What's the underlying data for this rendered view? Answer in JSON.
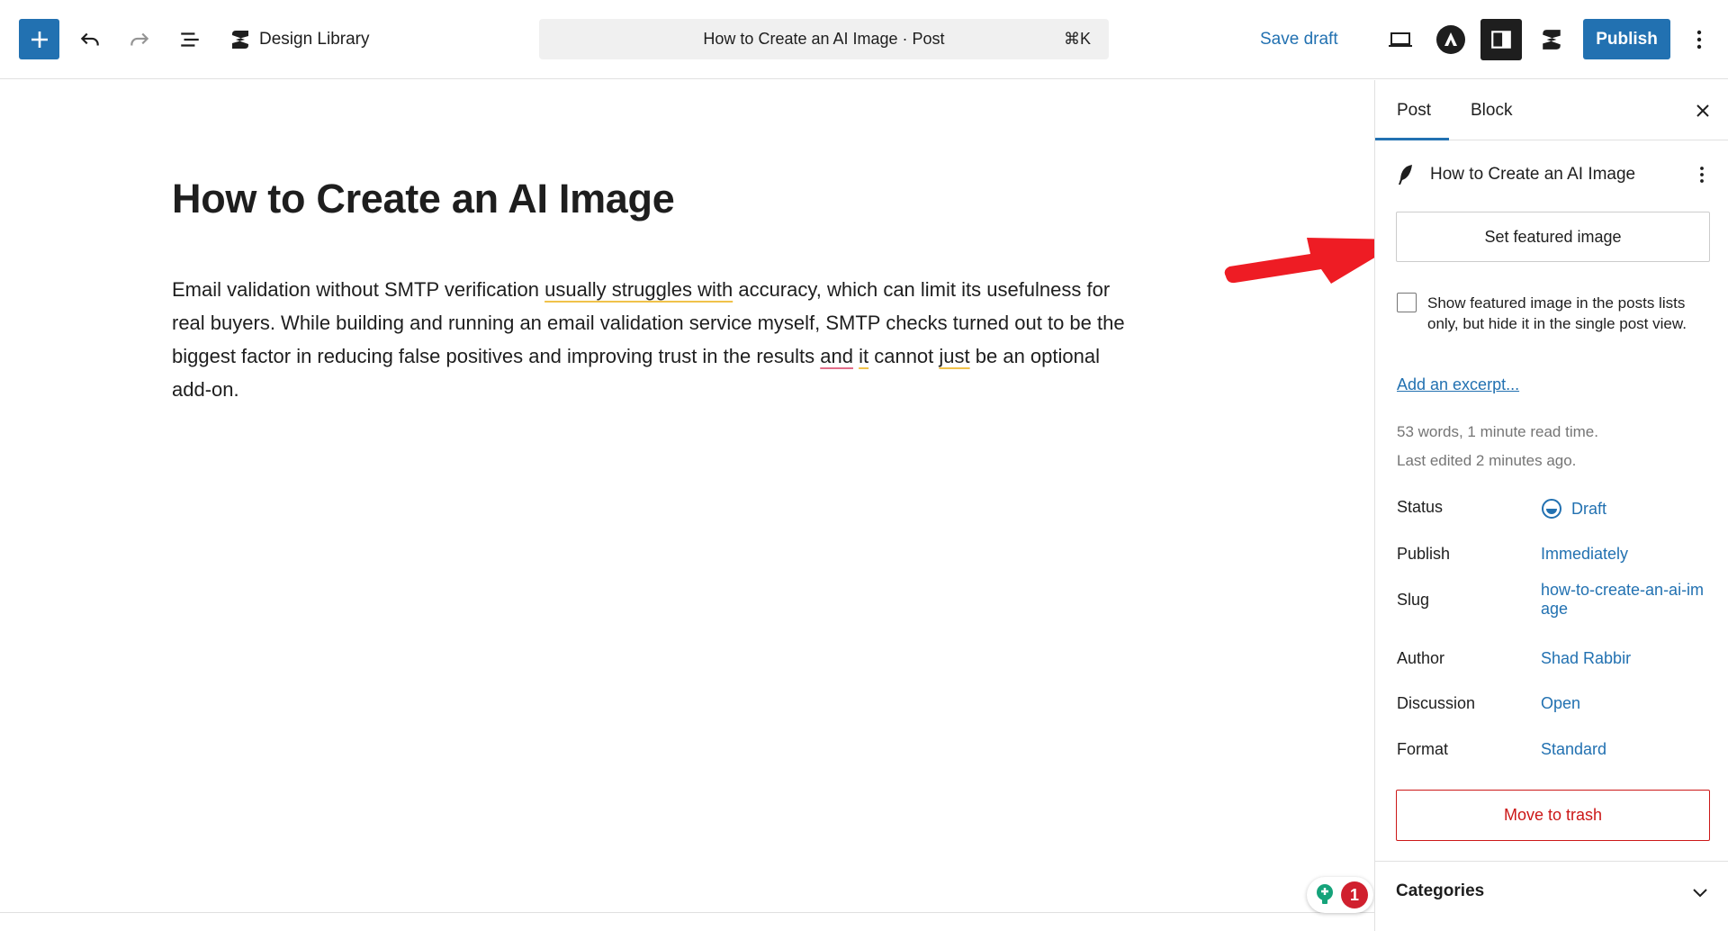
{
  "toolbar": {
    "add_icon": "plus-icon",
    "undo_icon": "undo-icon",
    "redo_icon": "redo-icon",
    "list_view_icon": "list-view-icon",
    "design_library_label": "Design Library",
    "command_bar_title": "How to Create an AI Image · Post",
    "command_shortcut": "⌘K",
    "save_draft_label": "Save draft",
    "publish_label": "Publish",
    "accent_color": "#2271b1"
  },
  "editor": {
    "title": "How to Create an AI Image",
    "paragraph": {
      "part1": "Email validation without SMTP verification ",
      "flag1": "usually struggles with",
      "part2": " accuracy, which can limit its usefulness for real buyers. While building and running an email validation service myself, SMTP checks turned out to be the biggest factor in reducing false positives and improving trust in the results ",
      "flag2": "and",
      "space": " ",
      "flag3": "it",
      "part3": " cannot ",
      "flag4": "just",
      "part4": " be an optional add-on."
    },
    "grammar_issue_count": "1"
  },
  "sidebar": {
    "tabs": [
      {
        "label": "Post",
        "active": true
      },
      {
        "label": "Block",
        "active": false
      }
    ],
    "document_title": "How to Create an AI Image",
    "featured_image_button": "Set featured image",
    "featured_image_option": "Show featured image in the posts lists only, but hide it in the single post view.",
    "featured_image_option_checked": false,
    "excerpt_link": "Add an excerpt...",
    "word_count": "53 words, 1 minute read time.",
    "last_edited": "Last edited 2 minutes ago.",
    "properties": [
      {
        "label": "Status",
        "value": "Draft"
      },
      {
        "label": "Publish",
        "value": "Immediately"
      },
      {
        "label": "Slug",
        "value": "how-to-create-an-ai-image"
      },
      {
        "label": "Author",
        "value": "Shad Rabbir"
      },
      {
        "label": "Discussion",
        "value": "Open"
      },
      {
        "label": "Format",
        "value": "Standard"
      }
    ],
    "trash_label": "Move to trash",
    "trash_color": "#cc1818",
    "categories_label": "Categories"
  },
  "annotation": {
    "arrow_color": "#ee1c24"
  }
}
